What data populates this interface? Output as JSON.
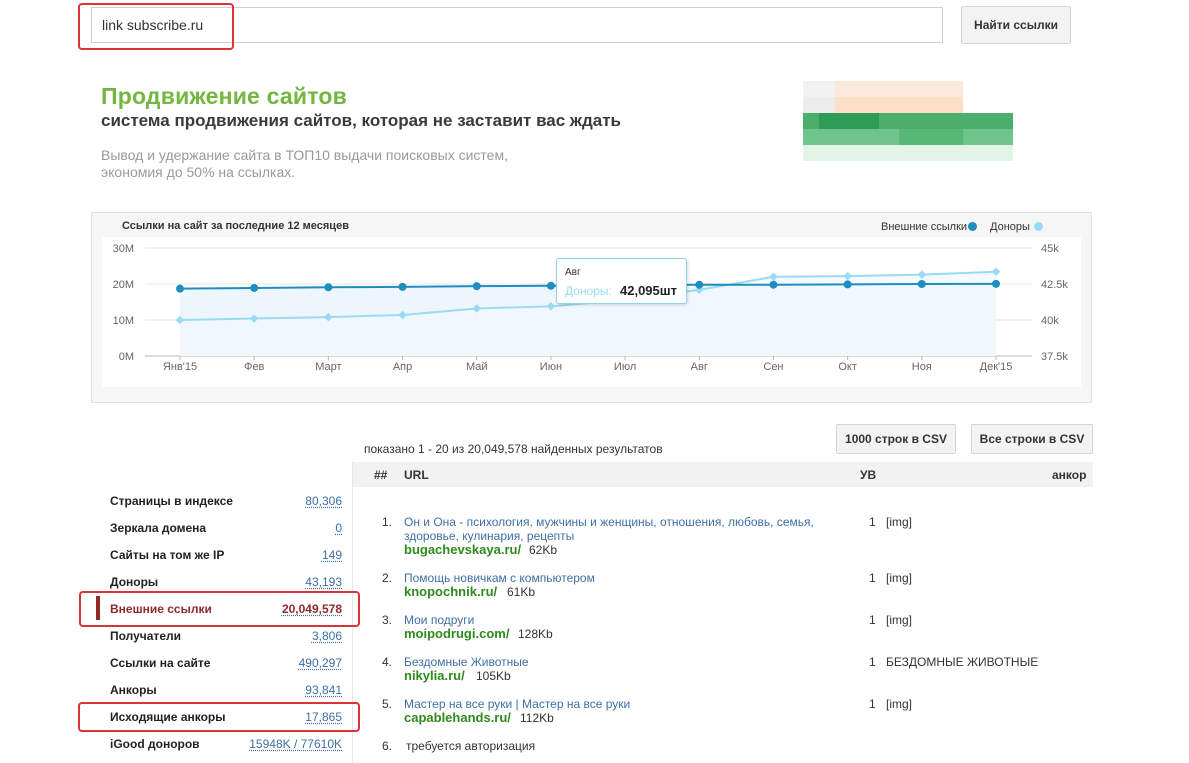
{
  "search": {
    "value": "link subscribe.ru",
    "button_label": "Найти ссылки"
  },
  "promo": {
    "title": "Продвижение сайтов",
    "subtitle": "система продвижения сайтов, которая не заставит вас ждать",
    "description_line1": "Вывод и удержание сайта в ТОП10 выдачи поисковых систем,",
    "description_line2": "экономия до 50% на ссылках."
  },
  "chart_data": {
    "type": "line",
    "title": "Ссылки на сайт за последние 12 месяцев",
    "categories": [
      "Янв'15",
      "Фев",
      "Март",
      "Апр",
      "Май",
      "Июн",
      "Июл",
      "Авг",
      "Сен",
      "Окт",
      "Ноя",
      "Дек'15"
    ],
    "series": [
      {
        "name": "Внешние ссылки",
        "axis": "left",
        "color": "#1f8ebf",
        "values": [
          18.7,
          18.9,
          19.1,
          19.2,
          19.4,
          19.5,
          19.7,
          19.8,
          19.8,
          19.9,
          20.0,
          20.05
        ]
      },
      {
        "name": "Доноры",
        "axis": "right",
        "color": "#9adaf2",
        "values": [
          40.0,
          40.1,
          40.2,
          40.35,
          40.8,
          40.95,
          41.4,
          42.095,
          43.0,
          43.05,
          43.15,
          43.35
        ]
      }
    ],
    "y_left": {
      "min": 0,
      "max": 30,
      "ticks": [
        0,
        10,
        20,
        30
      ],
      "tick_labels": [
        "0M",
        "10M",
        "20M",
        "30M"
      ]
    },
    "y_right": {
      "min": 37.5,
      "max": 45,
      "ticks": [
        37.5,
        40,
        42.5,
        45
      ],
      "tick_labels": [
        "37.5k",
        "40k",
        "42.5k",
        "45k"
      ]
    },
    "grid": true,
    "legend_position": "top-right",
    "tooltip": {
      "category": "Авг",
      "series": "Доноры:",
      "value": "42,095шт"
    }
  },
  "results": {
    "count_text": "показано 1 - 20 из 20,049,578 найденных результатов",
    "csv_1000_label": "1000 строк в CSV",
    "csv_all_label": "Все строки в CSV",
    "columns": {
      "num": "##",
      "url": "URL",
      "uv": "УВ",
      "anchor": "анкор"
    },
    "rows": [
      {
        "num": "1.",
        "title_line1": "Он и Она - психология, мужчины и женщины, отношения, любовь, семья,",
        "title_line2": "здоровье, кулинария, рецепты",
        "domain": "bugachevskaya.ru/",
        "size": "62Kb",
        "uv": "1",
        "anchor": "[img]"
      },
      {
        "num": "2.",
        "title_line1": "Помощь новичкам с компьютером",
        "title_line2": "",
        "domain": "knopochnik.ru/",
        "size": "61Kb",
        "uv": "1",
        "anchor": "[img]"
      },
      {
        "num": "3.",
        "title_line1": "Мои подруги",
        "title_line2": "",
        "domain": "moipodrugi.com/",
        "size": "128Kb",
        "uv": "1",
        "anchor": "[img]"
      },
      {
        "num": "4.",
        "title_line1": "Бездомные Животные",
        "title_line2": "",
        "domain": "nikylia.ru/",
        "size": "105Kb",
        "uv": "1",
        "anchor": "БЕЗДОМНЫЕ ЖИВОТНЫЕ"
      },
      {
        "num": "5.",
        "title_line1": "Мастер на все руки | Мастер на все руки",
        "title_line2": "",
        "domain": "capablehands.ru/",
        "size": "112Kb",
        "uv": "1",
        "anchor": "[img]"
      },
      {
        "num": "6.",
        "note": "требуется авторизация"
      }
    ]
  },
  "stats": [
    {
      "label": "Страницы в индексе",
      "value": "80,306"
    },
    {
      "label": "Зеркала домена",
      "value": "0"
    },
    {
      "label": "Сайты на том же IP",
      "value": "149"
    },
    {
      "label": "Доноры",
      "value": "43,193"
    },
    {
      "label": "Внешние ссылки",
      "value": "20,049,578",
      "active": true
    },
    {
      "label": "Получатели",
      "value": "3,806"
    },
    {
      "label": "Ссылки на сайте",
      "value": "490,297"
    },
    {
      "label": "Анкоры",
      "value": "93,841"
    },
    {
      "label": "Исходящие анкоры",
      "value": "17,865"
    },
    {
      "label": "iGood доноров",
      "value": "15948K / 77610K"
    }
  ],
  "colors": {
    "highlight_red": "#d9343a",
    "brand_green": "#74b63f",
    "link_blue": "#3d6fa5",
    "domain_green": "#2f8a1d",
    "active_maroon": "#8e2a2a"
  }
}
